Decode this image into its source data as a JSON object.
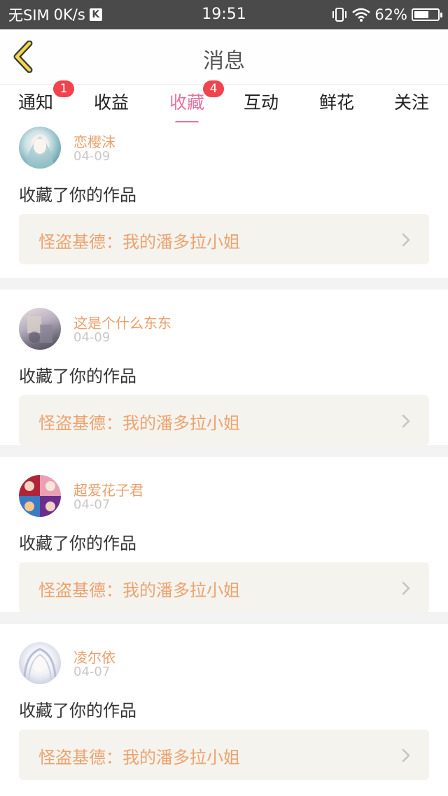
{
  "status_bar": {
    "carrier": "无SIM",
    "speed": "0K/s",
    "app_badge": "K",
    "time": "19:51",
    "battery_text": "62%",
    "battery_level": 0.62,
    "icons": [
      "vibrate-icon",
      "wifi-icon",
      "battery-icon"
    ]
  },
  "header": {
    "title": "消息",
    "back_icon": "back-chevron-icon"
  },
  "tabs": [
    {
      "label": "通知",
      "badge": "1"
    },
    {
      "label": "收益",
      "badge": ""
    },
    {
      "label": "收藏",
      "badge": "4",
      "active": true
    },
    {
      "label": "互动",
      "badge": ""
    },
    {
      "label": "鲜花",
      "badge": ""
    },
    {
      "label": "关注",
      "badge": ""
    }
  ],
  "feed": [
    {
      "username": "恋樱沫",
      "date": "04-09",
      "action": "收藏了你的作品",
      "work_title": "怪盗基德：我的潘多拉小姐"
    },
    {
      "username": "这是个什么东东",
      "date": "04-09",
      "action": "收藏了你的作品",
      "work_title": "怪盗基德：我的潘多拉小姐"
    },
    {
      "username": "超爱花子君",
      "date": "04-07",
      "action": "收藏了你的作品",
      "work_title": "怪盗基德：我的潘多拉小姐"
    },
    {
      "username": "凌尔依",
      "date": "04-07",
      "action": "收藏了你的作品",
      "work_title": "怪盗基德：我的潘多拉小姐"
    }
  ],
  "colors": {
    "accent": "#e8719e",
    "badge": "#f0434d",
    "username": "#e9a06c",
    "work_title": "#eda36f",
    "status_bar": "#4a4a4a"
  }
}
